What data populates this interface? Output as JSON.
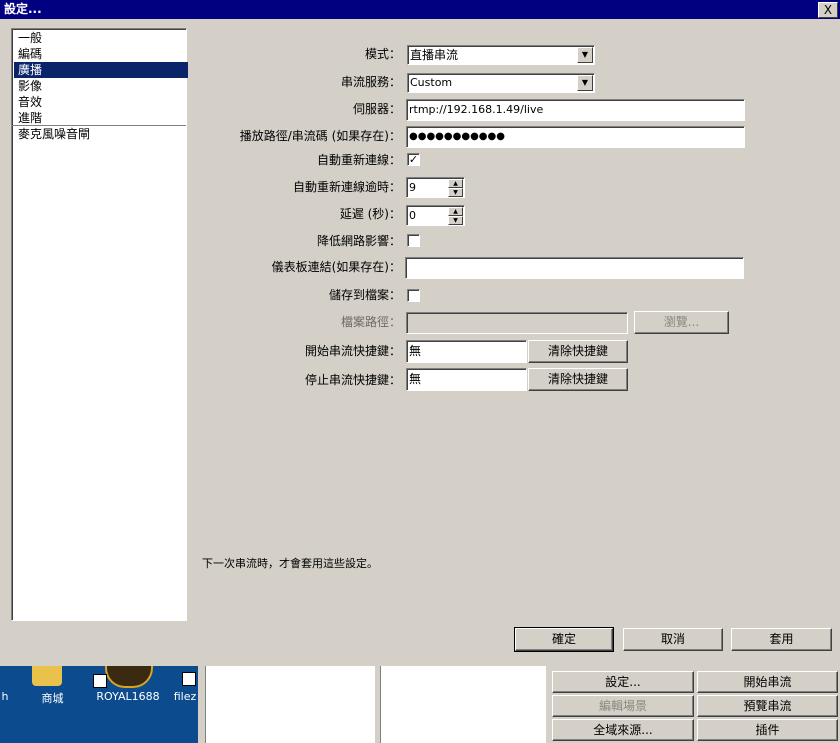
{
  "window": {
    "title": "設定...",
    "close": "X"
  },
  "categories": [
    "一般",
    "編碼",
    "廣播",
    "影像",
    "音效",
    "進階",
    "麥克風噪音閘"
  ],
  "form": {
    "mode_label": "模式：",
    "mode_value": "直播串流",
    "service_label": "串流服務：",
    "service_value": "Custom",
    "server_label": "伺服器：",
    "server_value": "rtmp://192.168.1.49/live",
    "key_label": "播放路徑/串流碼 (如果存在)：",
    "key_value": "●●●●●●●●●●●",
    "autoreconnect_label": "自動重新連線：",
    "autoreconnect_checked": true,
    "autoreconnect_mark": "✓",
    "timeout_label": "自動重新連線逾時：",
    "timeout_value": "9",
    "delay_label": "延遲 (秒)：",
    "delay_value": "0",
    "lownet_label": "降低網路影響：",
    "dashboard_label": "儀表板連結(如果存在)：",
    "dashboard_value": "",
    "savefile_label": "儲存到檔案：",
    "filepath_label": "檔案路徑：",
    "filepath_value": "",
    "browse": "瀏覽...",
    "start_hotkey_label": "開始串流快捷鍵：",
    "start_hotkey_value": "無",
    "start_clear": "清除快捷鍵",
    "stop_hotkey_label": "停止串流快捷鍵：",
    "stop_hotkey_value": "無",
    "stop_clear": "清除快捷鍵"
  },
  "note": "下一次串流時，才會套用這些設定。",
  "buttons": {
    "ok": "確定",
    "cancel": "取消",
    "apply": "套用"
  },
  "desktop": {
    "icons": [
      "h",
      "商城",
      "ROYAL1688",
      "filez"
    ]
  },
  "background_panel": {
    "buttons": [
      "設定...",
      "開始串流",
      "編輯場景",
      "預覽串流",
      "全域來源...",
      "插件"
    ]
  }
}
